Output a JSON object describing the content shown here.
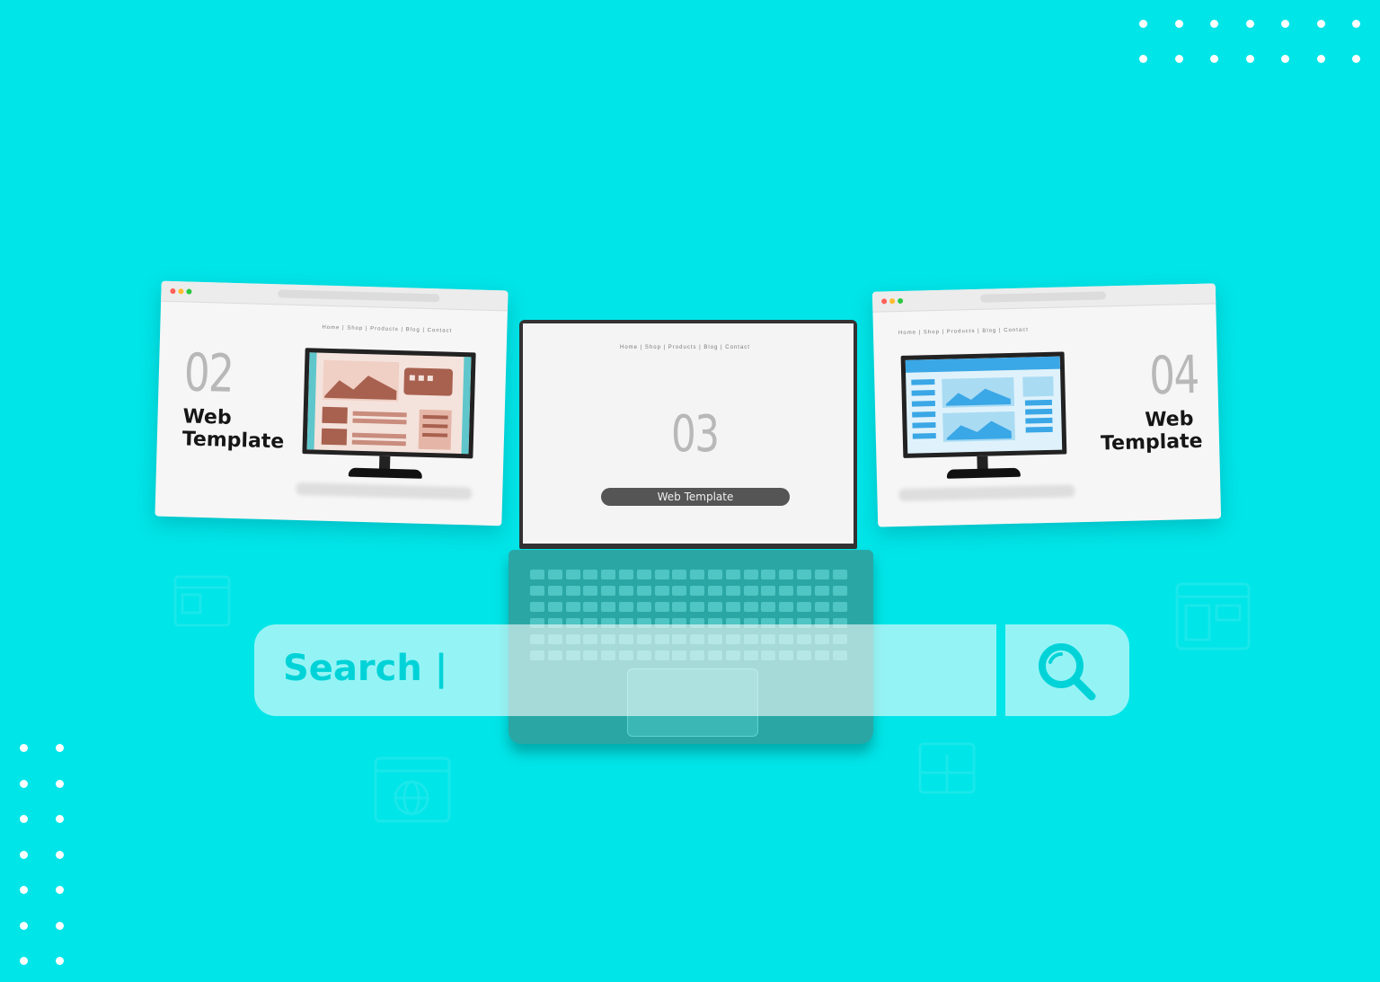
{
  "colors": {
    "background": "#00e5e8",
    "search_accent": "#00d3d8",
    "card_bg": "#f6f6f6",
    "monitor_left_accent": "#b06a5c",
    "monitor_right_accent": "#3aa7e6"
  },
  "left_card": {
    "number": "02",
    "title_line1": "Web",
    "title_line2": "Template",
    "nav": "Home  |  Shop  |  Products  |  Blog  |  Contact"
  },
  "center_laptop": {
    "number": "03",
    "pill_label": "Web Template",
    "nav": "Home  |  Shop  |  Products  |  Blog  |  Contact"
  },
  "right_card": {
    "number": "04",
    "title_line1": "Web",
    "title_line2": "Template",
    "nav": "Home  |  Shop  |  Products  |  Blog  |  Contact"
  },
  "search": {
    "text": "Search |",
    "button_icon": "search-icon"
  }
}
